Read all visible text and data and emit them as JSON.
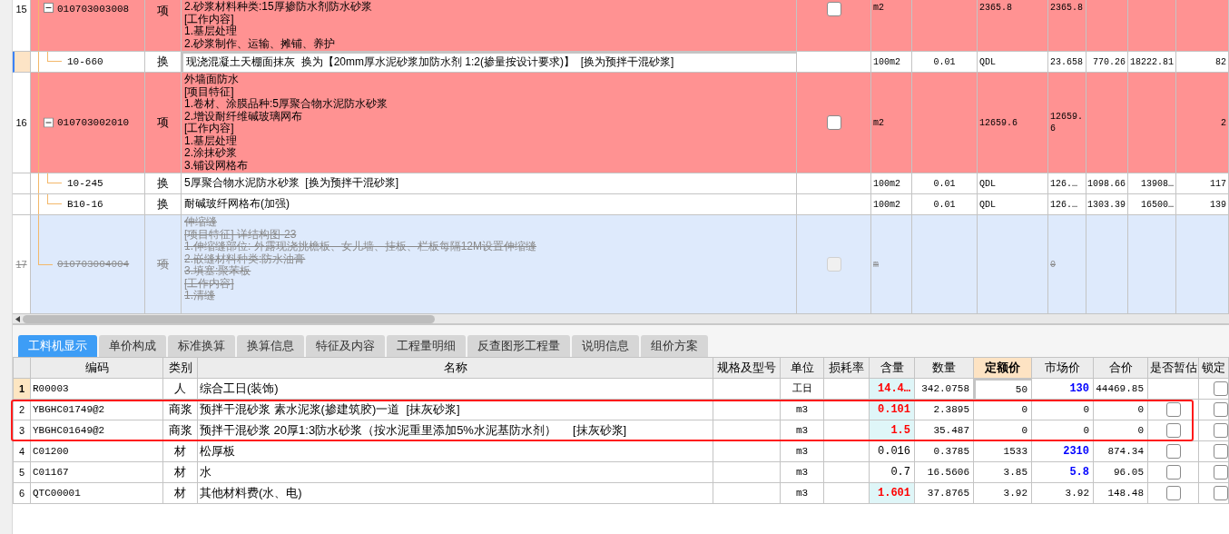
{
  "boq_rows": [
    {
      "number": "15",
      "code": "010703003008",
      "kind": "list_item",
      "expanded": true,
      "type": "项",
      "description": [
        "2.砂浆材料种类:15厚掺防水剂防水砂浆",
        "[工作内容]",
        "1.基层处理",
        "2.砂浆制作、运输、摊铺、养护"
      ],
      "checkbox": {
        "checked": false,
        "disabled": false
      },
      "cells": [
        "m2",
        "",
        "2365.8",
        "2365.8",
        "",
        "",
        ""
      ],
      "selected": false,
      "deleted": false
    },
    {
      "number": "",
      "code": "10-660",
      "kind": "quota",
      "type": "换",
      "description": [
        "现浇混凝土天棚面抹灰  换为【20mm厚水泥砂浆加防水剂 1:2(掺量按设计要求)】  [换为预拌干混砂浆]"
      ],
      "cells": [
        "100m2",
        "0.01",
        "QDL",
        "23.658",
        "770.26",
        "18222.81",
        "82"
      ],
      "selected": true,
      "deleted": false
    },
    {
      "number": "16",
      "code": "010703002010",
      "kind": "list_item",
      "expanded": true,
      "type": "项",
      "description": [
        "外墙面防水",
        "[项目特征]",
        "1.卷材、涂膜品种:5厚聚合物水泥防水砂浆",
        "2.增设耐纤维碱玻璃网布",
        "[工作内容]",
        "1.基层处理",
        "2.涂抹砂浆",
        "3.铺设网格布"
      ],
      "checkbox": {
        "checked": false,
        "disabled": false
      },
      "cells": [
        "m2",
        "",
        "12659.6",
        "12659.6",
        "",
        "",
        "2"
      ],
      "selected": false,
      "deleted": false
    },
    {
      "number": "",
      "code": "10-245",
      "kind": "quota",
      "type": "换",
      "description": [
        "5厚聚合物水泥防水砂浆  [换为预拌干混砂浆]"
      ],
      "cells": [
        "100m2",
        "0.01",
        "QDL",
        "126.…",
        "1098.66",
        "13908…",
        "117"
      ],
      "selected": false,
      "deleted": false
    },
    {
      "number": "",
      "code": "B10-16",
      "kind": "quota",
      "type": "换",
      "description": [
        "耐碱玻纤网格布(加强)"
      ],
      "cells": [
        "100m2",
        "0.01",
        "QDL",
        "126.…",
        "1303.39",
        "16500…",
        "139"
      ],
      "selected": false,
      "deleted": false
    },
    {
      "number": "17",
      "code": "010703004004",
      "kind": "list_item",
      "type": "项",
      "description": [
        "伸缩缝",
        "[项目特征] 详结构图-23",
        "1.伸缩缝部位: 外露现浇挑檐板、女儿墙、挂板、栏板每隔12M设置伸缩缝",
        "2.嵌缝材料种类:防水油膏",
        "3.填塞:聚苯板",
        "[工作内容]",
        "1.清缝"
      ],
      "checkbox": {
        "checked": false,
        "disabled": true
      },
      "cells": [
        "m",
        "",
        "",
        "0",
        "",
        "",
        ""
      ],
      "selected": false,
      "deleted": true
    }
  ],
  "tabs": [
    {
      "label": "工料机显示",
      "selected": true
    },
    {
      "label": "单价构成",
      "selected": false
    },
    {
      "label": "标准换算",
      "selected": false
    },
    {
      "label": "换算信息",
      "selected": false
    },
    {
      "label": "特征及内容",
      "selected": false
    },
    {
      "label": "工程量明细",
      "selected": false
    },
    {
      "label": "反查图形工程量",
      "selected": false
    },
    {
      "label": "说明信息",
      "selected": false
    },
    {
      "label": "组价方案",
      "selected": false
    }
  ],
  "resource_table": {
    "columns": [
      {
        "label": "编码",
        "selected": false
      },
      {
        "label": "类别",
        "selected": false
      },
      {
        "label": "名称",
        "selected": false
      },
      {
        "label": "规格及型号",
        "selected": false
      },
      {
        "label": "单位",
        "selected": false
      },
      {
        "label": "损耗率",
        "selected": false
      },
      {
        "label": "含量",
        "selected": false
      },
      {
        "label": "数量",
        "selected": false
      },
      {
        "label": "定额价",
        "selected": true
      },
      {
        "label": "市场价",
        "selected": false
      },
      {
        "label": "合价",
        "selected": false
      },
      {
        "label": "是否暂估",
        "selected": false
      },
      {
        "label": "锁定",
        "selected": false
      }
    ],
    "rows": [
      {
        "number": "1",
        "code": "R00003",
        "type": "人",
        "name": "综合工日(装饰)",
        "spec": "",
        "unit": "工日",
        "loss": "",
        "content": "14.4…",
        "content_modified": true,
        "quantity": "342.0758",
        "quota_price": "50",
        "market_price": "130",
        "market_modified": true,
        "total": "44469.85",
        "locked": false,
        "selected": true,
        "outlined": false
      },
      {
        "number": "2",
        "code": "YBGHC01749@2",
        "type": "商浆",
        "name": "预拌干混砂浆 素水泥浆(掺建筑胶)一道  [抹灰砂浆]",
        "spec": "",
        "unit": "m3",
        "loss": "",
        "content": "0.101",
        "content_modified": true,
        "quantity": "2.3895",
        "quota_price": "0",
        "market_price": "0",
        "market_modified": false,
        "total": "0",
        "estimate": false,
        "locked": false,
        "selected": false,
        "outlined": true
      },
      {
        "number": "3",
        "code": "YBGHC01649@2",
        "type": "商浆",
        "name": "预拌干混砂浆 20厚1:3防水砂浆（按水泥重里添加5%水泥基防水剂）     [抹灰砂浆]",
        "spec": "",
        "unit": "m3",
        "loss": "",
        "content": "1.5",
        "content_modified": true,
        "quantity": "35.487",
        "quota_price": "0",
        "market_price": "0",
        "market_modified": false,
        "total": "0",
        "estimate": false,
        "locked": false,
        "selected": false,
        "outlined": true
      },
      {
        "number": "4",
        "code": "C01200",
        "type": "材",
        "name": "松厚板",
        "spec": "",
        "unit": "m3",
        "loss": "",
        "content": "0.016",
        "content_modified": false,
        "quantity": "0.3785",
        "quota_price": "1533",
        "market_price": "2310",
        "market_modified": true,
        "total": "874.34",
        "estimate": false,
        "locked": false,
        "selected": false,
        "outlined": false
      },
      {
        "number": "5",
        "code": "C01167",
        "type": "材",
        "name": "水",
        "spec": "",
        "unit": "m3",
        "loss": "",
        "content": "0.7",
        "content_modified": false,
        "quantity": "16.5606",
        "quota_price": "3.85",
        "market_price": "5.8",
        "market_modified": true,
        "total": "96.05",
        "estimate": false,
        "locked": false,
        "selected": false,
        "outlined": false
      },
      {
        "number": "6",
        "code": "QTC00001",
        "type": "材",
        "name": "其他材料费(水、电)",
        "spec": "",
        "unit": "m3",
        "loss": "",
        "content": "1.601",
        "content_modified": true,
        "quantity": "37.8765",
        "quota_price": "3.92",
        "market_price": "3.92",
        "market_modified": false,
        "total": "148.48",
        "estimate": false,
        "locked": false,
        "selected": false,
        "outlined": false
      }
    ]
  }
}
